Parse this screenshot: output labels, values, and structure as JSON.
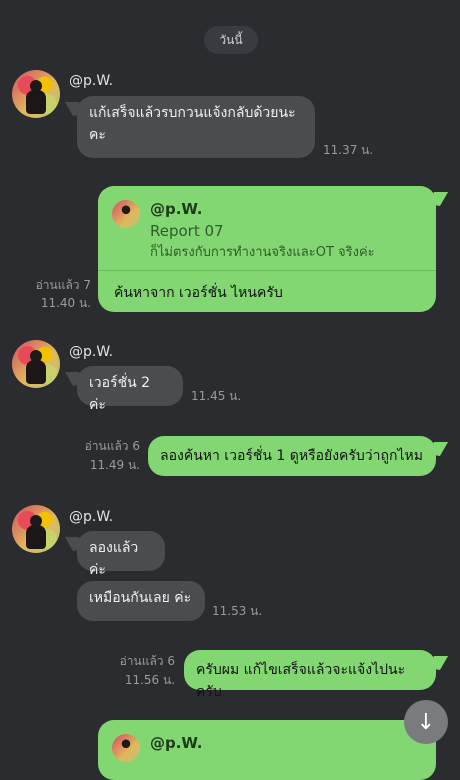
{
  "date_separator": "วันนี้",
  "messages": {
    "m1": {
      "sender": "@p.W.",
      "text": "แก้เสร็จแล้วรบกวนแจ้งกลับด้วยนะคะ",
      "time": "11.37 น."
    },
    "m2": {
      "reply_name": "@p.W.",
      "reply_title": "Report 07",
      "reply_excerpt": "ก็ไม่ตรงกับการทำงานจริงและOT จริงค่ะ",
      "text": "ค้นหาจาก เวอร์ชั่น ไหนครับ",
      "read_status": "อ่านแล้ว 7",
      "time": "11.40 น."
    },
    "m3": {
      "sender": "@p.W.",
      "text": "เวอร์ชั่น 2 ค่ะ",
      "time": "11.45 น."
    },
    "m4": {
      "text": "ลองค้นหา เวอร์ชั่น 1 ดูหรือยังครับว่าถูกไหม",
      "read_status": "อ่านแล้ว 6",
      "time": "11.49 น."
    },
    "m5": {
      "sender": "@p.W.",
      "text1": "ลองแล้วค่ะ",
      "text2": "เหมือนกันเลย ค่ะ",
      "time": "11.53 น."
    },
    "m6": {
      "text": "ครับผม แก้ไขเสร็จแล้วจะแจ้งไปนะครับ",
      "read_status": "อ่านแล้ว 6",
      "time": "11.56 น."
    },
    "m7": {
      "reply_name": "@p.W."
    }
  },
  "scroll_button_icon": "arrow-down-icon",
  "colors": {
    "background": "#2b2c30",
    "incoming_bubble": "#4b4c50",
    "outgoing_bubble": "#83d773"
  }
}
